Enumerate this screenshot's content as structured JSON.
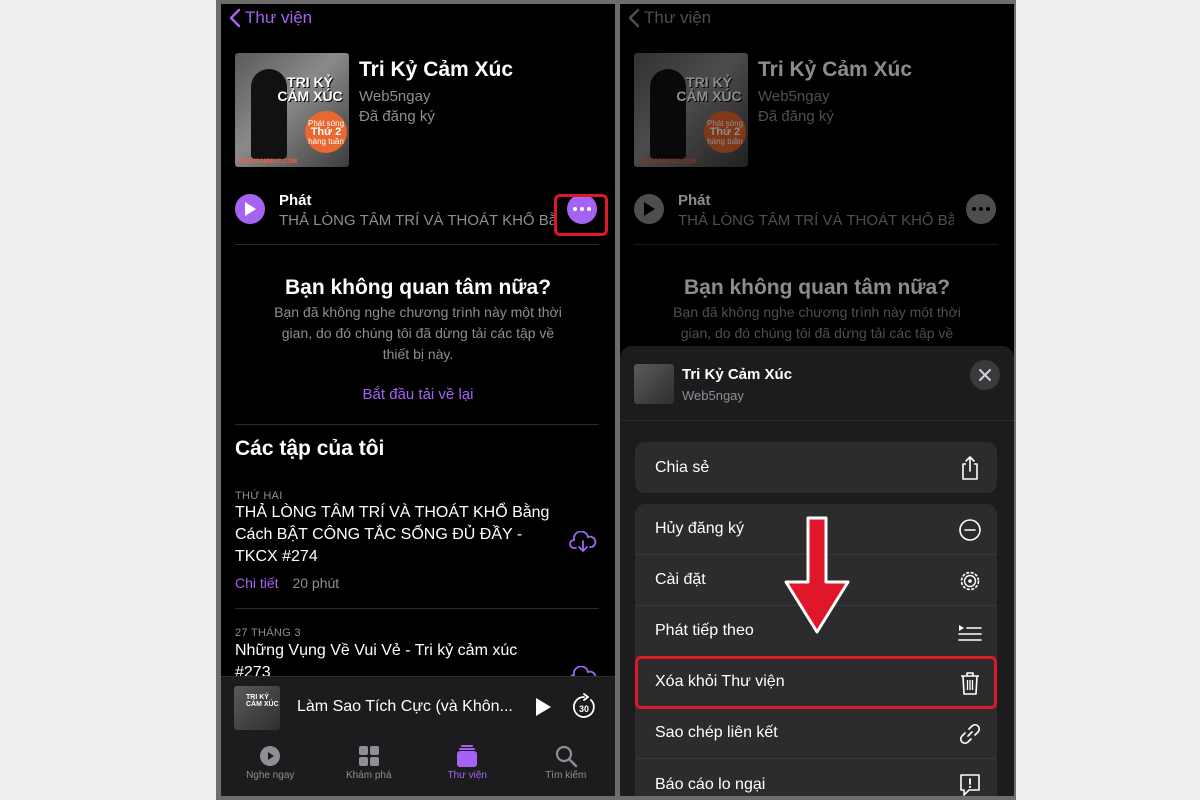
{
  "left": {
    "nav": {
      "back_label": "Thư viện"
    },
    "podcast": {
      "cover_title": "TRI KỶ CẢM XÚC",
      "cover_badge_top": "Phát sóng",
      "cover_badge_mid": "Thứ 2",
      "cover_badge_bottom": "hàng tuần",
      "cover_site": "TRIKYCAMXUC.COM",
      "title": "Tri Kỷ Cảm Xúc",
      "author": "Web5ngay",
      "status": "Đã đăng ký"
    },
    "play": {
      "label": "Phát",
      "episode": "THẢ LÒNG TÂM TRÍ VÀ THOÁT KHỔ Bằ..."
    },
    "notice": {
      "title": "Bạn không quan tâm nữa?",
      "desc": "Bạn đã không nghe chương trình này một thời gian, do đó chúng tôi đã dừng tải các tập về thiết bị này.",
      "link": "Bắt đầu tải về lại"
    },
    "episodes_title": "Các tập của tôi",
    "episodes": [
      {
        "date": "THỨ HAI",
        "title": "THẢ LÒNG TÂM TRÍ VÀ THOÁT KHỔ Bằng Cách BẬT CÔNG TẮC SỐNG ĐỦ ĐẦY - TKCX #274",
        "detail": "Chi tiết",
        "duration": "20 phút"
      },
      {
        "date": "27 THÁNG 3",
        "title": "Những Vụng Về Vui Vẻ - Tri kỷ cảm xúc #273"
      }
    ],
    "mini_player": {
      "cover_title": "TRI KỶ CẢM XÚC",
      "title": "Làm Sao Tích Cực (và Khôn...",
      "skip": "30"
    },
    "tabs": [
      {
        "label": "Nghe ngay"
      },
      {
        "label": "Khám phá"
      },
      {
        "label": "Thư viện"
      },
      {
        "label": "Tìm kiếm"
      }
    ]
  },
  "right": {
    "sheet": {
      "title": "Tri Kỷ Cảm Xúc",
      "author": "Web5ngay",
      "share": "Chia sẻ",
      "items": [
        {
          "label": "Hủy đăng ký",
          "icon": "minus-circle-icon"
        },
        {
          "label": "Cài đặt",
          "icon": "gear-icon"
        },
        {
          "label": "Phát tiếp theo",
          "icon": "play-next-icon"
        },
        {
          "label": "Xóa khỏi Thư viện",
          "icon": "trash-icon"
        },
        {
          "label": "Sao chép liên kết",
          "icon": "link-icon"
        },
        {
          "label": "Báo cáo lo ngại",
          "icon": "report-icon"
        }
      ]
    }
  },
  "colors": {
    "accent": "#a463f2",
    "highlight": "#e0162b",
    "background": "#000000"
  }
}
